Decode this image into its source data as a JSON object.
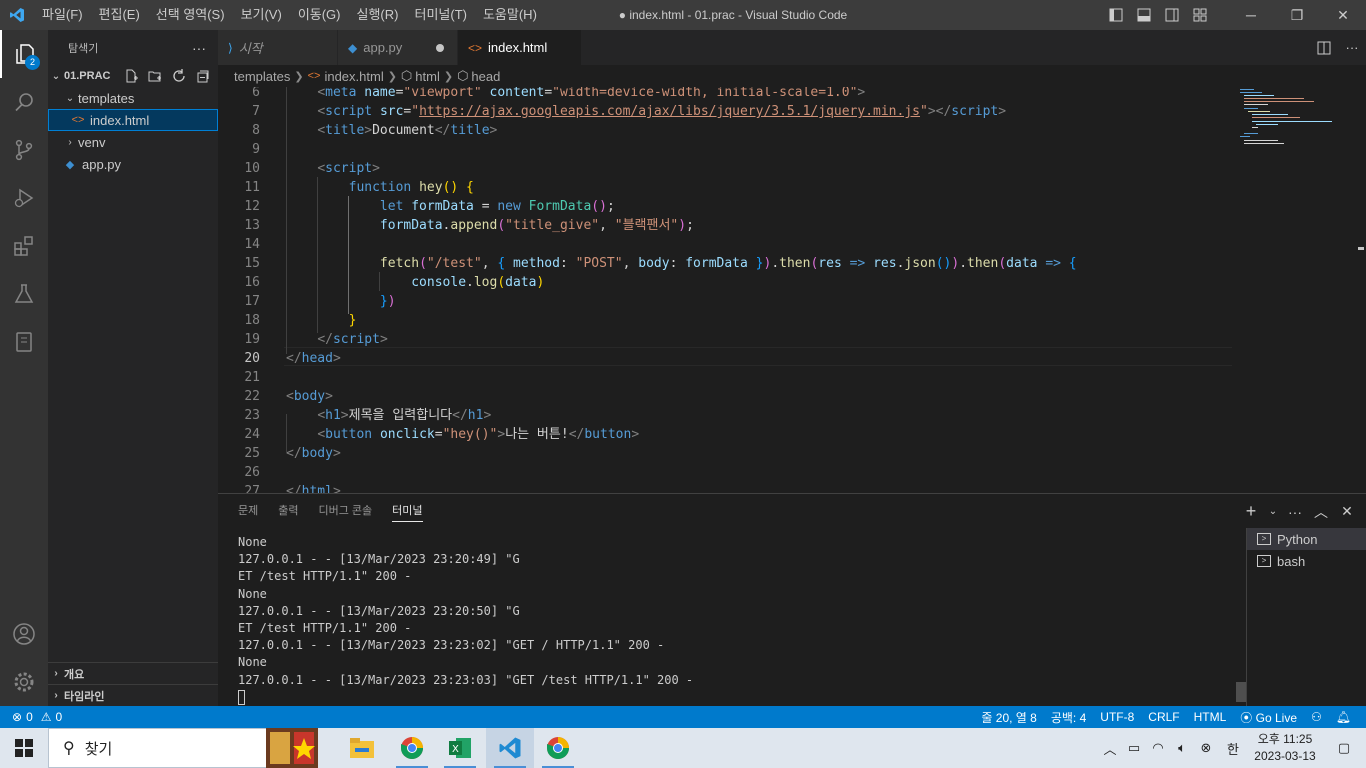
{
  "titlebar": {
    "menus": [
      "파일(F)",
      "편집(E)",
      "선택 영역(S)",
      "보기(V)",
      "이동(G)",
      "실행(R)",
      "터미널(T)",
      "도움말(H)"
    ],
    "title": "● index.html - 01.prac - Visual Studio Code"
  },
  "activitybar": {
    "explorer_badge": "2"
  },
  "sidebar": {
    "header": "탐색기",
    "more": "···",
    "folder": "01.PRAC",
    "tree": [
      {
        "label": "templates",
        "kind": "folder-open"
      },
      {
        "label": "index.html",
        "kind": "html",
        "selected": true
      },
      {
        "label": "venv",
        "kind": "folder-closed"
      },
      {
        "label": "app.py",
        "kind": "python"
      }
    ],
    "outline": "개요",
    "timeline": "타임라인"
  },
  "tabs": [
    {
      "label": "시작",
      "icon": "vscode-icon",
      "active": false,
      "dirty": false
    },
    {
      "label": "app.py",
      "icon": "python-icon",
      "active": false,
      "dirty": true
    },
    {
      "label": "index.html",
      "icon": "html-icon",
      "active": true,
      "dirty": true
    }
  ],
  "breadcrumb": {
    "folder": "templates",
    "file": "index.html",
    "sym1": "html",
    "sym2": "head"
  },
  "editor": {
    "line_numbers": [
      "6",
      "7",
      "8",
      "9",
      "10",
      "11",
      "12",
      "13",
      "14",
      "15",
      "16",
      "17",
      "18",
      "19",
      "20",
      "21",
      "22",
      "23",
      "24",
      "25",
      "26",
      "27"
    ],
    "current_line": "20",
    "cursor_position": "줄 20, 열 8"
  },
  "panel": {
    "tabs": [
      "문제",
      "출력",
      "디버그 콘솔",
      "터미널"
    ],
    "active_tab": "터미널",
    "terminal_lines": [
      "None",
      "127.0.0.1 - - [13/Mar/2023 23:20:49] \"G",
      "ET /test HTTP/1.1\" 200 -",
      "None",
      "127.0.0.1 - - [13/Mar/2023 23:20:50] \"G",
      "ET /test HTTP/1.1\" 200 -",
      "127.0.0.1 - - [13/Mar/2023 23:23:02] \"GET / HTTP/1.1\" 200 -",
      "None",
      "127.0.0.1 - - [13/Mar/2023 23:23:03] \"GET /test HTTP/1.1\" 200 -"
    ],
    "terminals": [
      "Python",
      "bash"
    ]
  },
  "statusbar": {
    "errors": "0",
    "warnings": "0",
    "position": "줄 20, 열 8",
    "spaces": "공백: 4",
    "encoding": "UTF-8",
    "eol": "CRLF",
    "language": "HTML",
    "golive": "Go Live"
  },
  "taskbar": {
    "search_placeholder": "찾기",
    "time_ampm": "오후 11:25",
    "date": "2023-03-13",
    "ime": "한"
  },
  "colors": {
    "accent": "#007acc",
    "titlebar": "#3c3c3c",
    "activitybar": "#333333",
    "sidebar": "#252526",
    "editor": "#1e1e1e"
  }
}
